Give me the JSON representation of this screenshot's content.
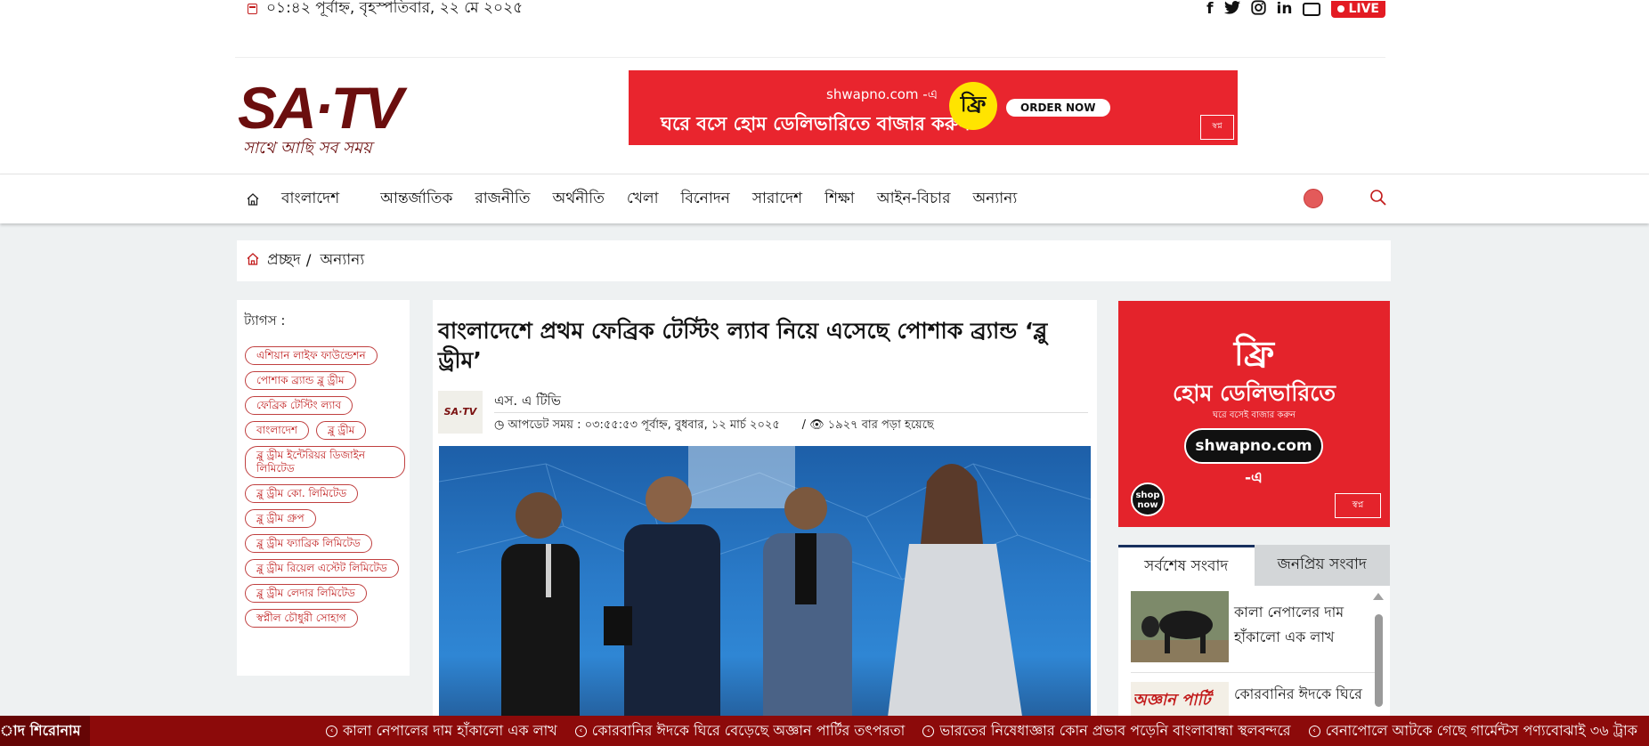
{
  "topbar": {
    "datetime": "০১:৪২ পূর্বাহ্ন, বৃহস্পতিবার, ২২ মে ২০২৫",
    "social": {
      "facebook": "f",
      "twitter": "𝕏",
      "instagram": "◎",
      "linkedin": "in"
    },
    "live_label": "LIVE"
  },
  "logo": {
    "main": "SA·TV",
    "tagline": "সাথে আছি সব সময়"
  },
  "header_ad": {
    "site": "shwapno.com -এ",
    "text": "ঘরে বসে হোম ডেলিভারিতে বাজার করুন",
    "free": "ফ্রি",
    "order_button": "ORDER NOW",
    "logo": "স্বপ্ন"
  },
  "nav": {
    "items": [
      "বাংলাদেশ",
      "আন্তর্জাতিক",
      "রাজনীতি",
      "অর্থনীতি",
      "খেলা",
      "বিনোদন",
      "সারাদেশ",
      "শিক্ষা",
      "আইন-বিচার",
      "অন্যান্য"
    ]
  },
  "breadcrumb": {
    "home": "প্রচ্ছদ",
    "separator": "/",
    "current": "অন্যান্য"
  },
  "tags": {
    "title": "ট্যাগস :",
    "items": [
      "এশিয়ান লাইফ ফাউন্ডেশন",
      "পোশাক ব্র্যান্ড ব্লু ড্রীম",
      "ফেব্রিক টেস্টিং ল্যাব",
      "বাংলাদেশ",
      "ব্লু ড্রীম",
      "ব্লু ড্রীম ইন্টেরিয়র ডিজাইন লিমিটেড",
      "ব্লু ড্রীম কো. লিমিটেড",
      "ব্লু ড্রীম গ্রুপ",
      "ব্লু ড্রীম ফ্যাব্রিক লিমিটেড",
      "ব্লু ড্রীম রিয়েল এস্টেট লিমিটেড",
      "ব্লু ড্রীম লেদার লিমিটেড",
      "স্বপ্নীল চৌধুরী সোহাগ"
    ]
  },
  "article": {
    "title": "বাংলাদেশে প্রথম ফেব্রিক টেস্টিং ল্যাব নিয়ে এসেছে পোশাক ব্র্যান্ড ‘ব্লু ড্রীম’",
    "author_logo": "SA·TV",
    "author": "এস. এ টিভি",
    "updated": "আপডেট সময় : ০৩:৫৫:৫৩ পূর্বাহ্ন, বুধবার, ১২ মার্চ ২০২৫",
    "views": "১৯২৭ বার পড়া হয়েছে"
  },
  "side_ad": {
    "free": "ফ্রি",
    "home_delivery": "হোম ডেলিভারিতে",
    "small": "ঘরে বসেই বাজার করুন",
    "site": "shwapno.com -এ",
    "shop_now": "shop now",
    "logo": "স্বপ্ন"
  },
  "news_tabs": {
    "latest": "সর্বশেষ সংবাদ",
    "popular": "জনপ্রিয় সংবাদ"
  },
  "news_list": [
    {
      "title": "কালা নেপালের দাম হাঁকালো এক লাখ"
    },
    {
      "title": "কোরবানির ঈদকে ঘিরে",
      "thumb_text": "অজ্ঞান পার্টি"
    }
  ],
  "ticker": {
    "label": "াদ শিরোনাম",
    "items": [
      "কালা নেপালের দাম হাঁকালো এক লাখ",
      "কোরবানির ঈদকে ঘিরে বেড়েছে অজ্ঞান পার্টির তৎপরতা",
      "ভারতের নিষেধাজ্ঞার কোন প্রভাব পড়েনি বাংলাবান্ধা স্থলবন্দরে",
      "বেনাপোলে আটকে গেছে গার্মেন্টস পণ্যবোঝাই ৩৬ ট্রাক"
    ]
  },
  "colors": {
    "brand_red": "#e31b23",
    "logo_maroon": "#6b0e0e",
    "ticker_bg": "#8c0a0a",
    "tab_border": "#17305e"
  }
}
